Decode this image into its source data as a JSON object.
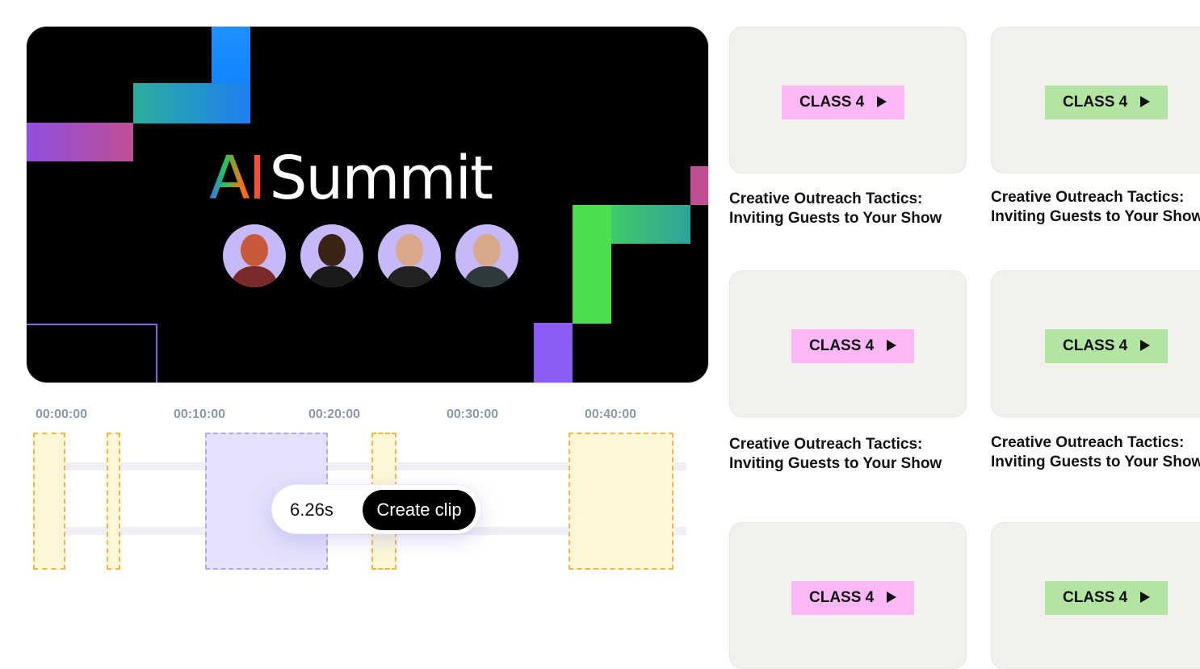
{
  "video": {
    "title_prefix": "AI",
    "title_main": "Summit",
    "speakers": [
      "speaker-1",
      "speaker-2",
      "speaker-3",
      "speaker-4"
    ]
  },
  "timeline": {
    "labels": [
      "00:00:00",
      "00:10:00",
      "00:20:00",
      "00:30:00",
      "00:40:00"
    ],
    "duration": "6.26s",
    "create_clip_label": "Create clip"
  },
  "classes": [
    {
      "badge": "CLASS 4",
      "title_line1": "Creative Outreach Tactics:",
      "title_line2": "Inviting Guests to Your Show",
      "badge_color": "#fcb8f5"
    },
    {
      "badge": "CLASS 4",
      "title_line1": "Creative Outreach Tactics:",
      "title_line2": "Inviting Guests to Your Show",
      "badge_color": "#b4e4a1"
    },
    {
      "badge": "CLASS 4",
      "title_line1": "Creative Outreach Tactics:",
      "title_line2": "Inviting Guests to Your Show",
      "badge_color": "#fcb8f5"
    },
    {
      "badge": "CLASS 4",
      "title_line1": "Creative Outreach Tactics:",
      "title_line2": "Inviting Guests to Your Show",
      "badge_color": "#b4e4a1"
    },
    {
      "badge": "CLASS 4",
      "title_line1": "",
      "title_line2": "",
      "badge_color": "#fcb8f5"
    },
    {
      "badge": "CLASS 4",
      "title_line1": "",
      "title_line2": "",
      "badge_color": "#b4e4a1"
    }
  ],
  "colors": {
    "accent_purple": "#8b5cf6",
    "segment_yellow": "#fdf7d8",
    "segment_purple": "#e3e1fb"
  }
}
